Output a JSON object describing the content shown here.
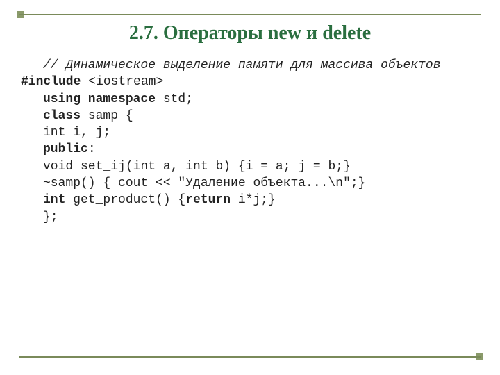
{
  "title": "2.7. Операторы new и delete",
  "code": {
    "l1": "// Динамическое выделение памяти для массива объектов",
    "l2a": "#include",
    "l2b": " <iostream>",
    "l3a": "using namespace",
    "l3b": " std;",
    "l4a": "class",
    "l4b": " samp {",
    "l5": "int i, j;",
    "l6a": "public",
    "l6b": ":",
    "l7": "void set_ij(int a, int b) {i = a; j = b;}",
    "l8": "~samp() { cout << \"Удаление объекта...\\n\";}",
    "l9a": "int",
    "l9b": " get_product() {",
    "l9c": "return",
    "l9d": " i*j;}",
    "l10": "};"
  }
}
